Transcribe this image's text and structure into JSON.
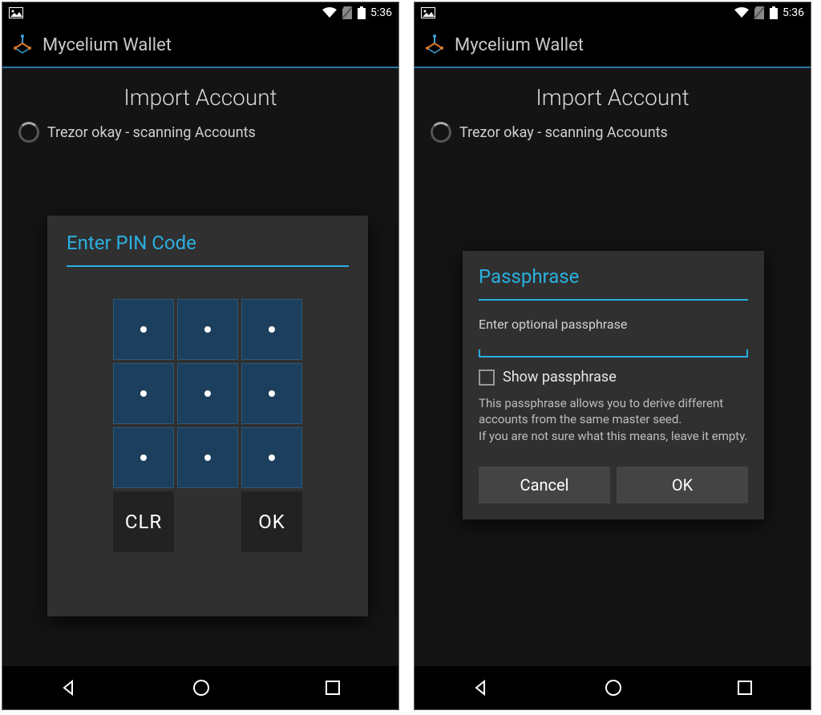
{
  "statusbar": {
    "time": "5:36"
  },
  "appbar": {
    "title": "Mycelium Wallet"
  },
  "page": {
    "title": "Import Account",
    "status_text": "Trezor okay - scanning Accounts"
  },
  "pin_dialog": {
    "title": "Enter PIN Code",
    "clr": "CLR",
    "ok": "OK"
  },
  "pass_dialog": {
    "title": "Passphrase",
    "label": "Enter optional passphrase",
    "input_value": "",
    "show_label": "Show passphrase",
    "description": "This passphrase allows you to derive different accounts from the same master seed.\nIf you are not sure what this means, leave it empty.",
    "cancel": "Cancel",
    "ok": "OK"
  },
  "icons": {
    "picture": "picture-icon",
    "wifi": "wifi-icon",
    "sim": "no-sim-icon",
    "battery": "battery-icon"
  }
}
